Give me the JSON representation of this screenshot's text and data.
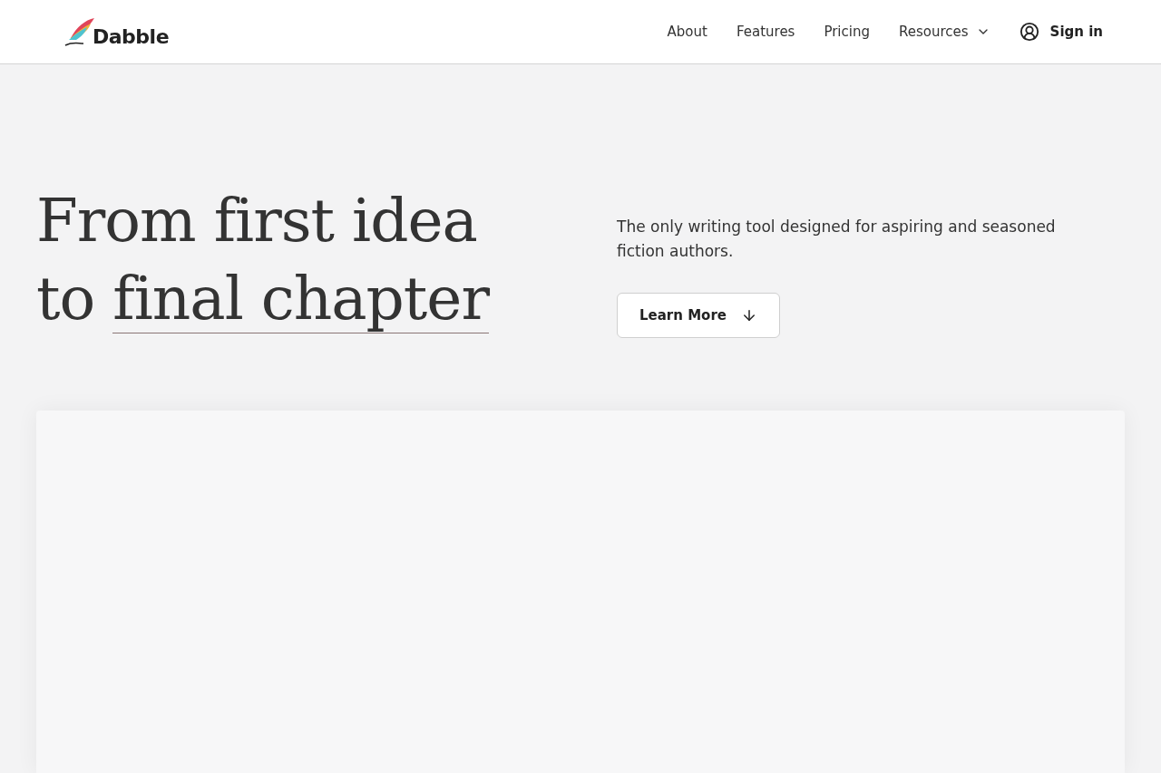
{
  "header": {
    "logo": {
      "text": "Dabble"
    },
    "nav": [
      {
        "label": "About",
        "kind": "link"
      },
      {
        "label": "Features",
        "kind": "link"
      },
      {
        "label": "Pricing",
        "kind": "link"
      },
      {
        "label": "Resources",
        "kind": "dropdown"
      }
    ],
    "sign_in": {
      "label": "Sign in"
    }
  },
  "hero": {
    "headline": [
      [
        {
          "text": "From first idea",
          "underlined": false
        }
      ],
      [
        {
          "text": "to",
          "underlined": false
        },
        {
          "text": "final chapter",
          "underlined": true
        }
      ]
    ],
    "tagline": "The only writing tool designed for aspiring and seasoned fiction authors.",
    "button": {
      "label": "Learn More"
    }
  }
}
